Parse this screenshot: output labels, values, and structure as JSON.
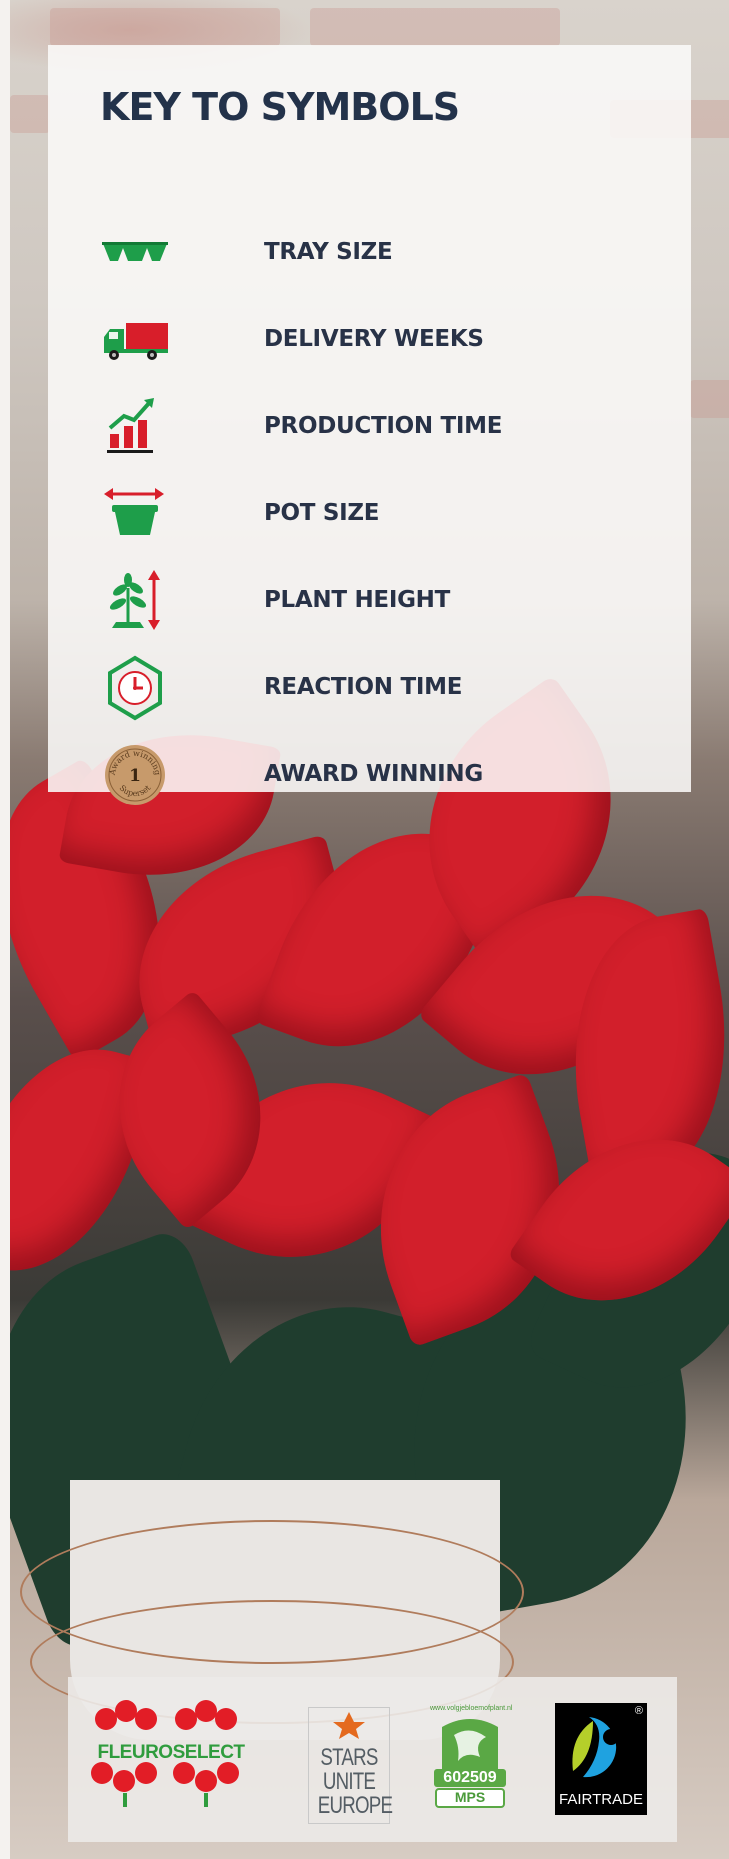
{
  "key": {
    "title": "KEY TO SYMBOLS",
    "items": [
      {
        "icon": "tray-size-icon",
        "label": "TRAY SIZE"
      },
      {
        "icon": "delivery-truck-icon",
        "label": "DELIVERY WEEKS"
      },
      {
        "icon": "production-chart-icon",
        "label": "PRODUCTION TIME"
      },
      {
        "icon": "pot-size-icon",
        "label": "POT SIZE"
      },
      {
        "icon": "plant-height-icon",
        "label": "PLANT HEIGHT"
      },
      {
        "icon": "reaction-clock-icon",
        "label": "REACTION TIME"
      },
      {
        "icon": "award-badge-icon",
        "label": "AWARD WINNING"
      }
    ],
    "award_badge": {
      "number": "1",
      "arc_top": "Award winning",
      "arc_bottom": "Superset"
    }
  },
  "certifications": {
    "fleuroselect": {
      "wordmark": "FLEUROSELECT"
    },
    "stars": {
      "line1": "STARS",
      "line2": "UNITE",
      "line3": "EUROPE"
    },
    "mps": {
      "url": "www.volgjebloemofplant.nl",
      "number": "602509",
      "label": "MPS"
    },
    "fairtrade": {
      "wordmark": "FAIRTRADE",
      "mark": "®"
    }
  },
  "colors": {
    "panel_text": "#283247",
    "icon_green": "#1e9e4a",
    "icon_red": "#d81e2a",
    "bract_red": "#d21f2b",
    "foliage": "#1f3d2e"
  }
}
